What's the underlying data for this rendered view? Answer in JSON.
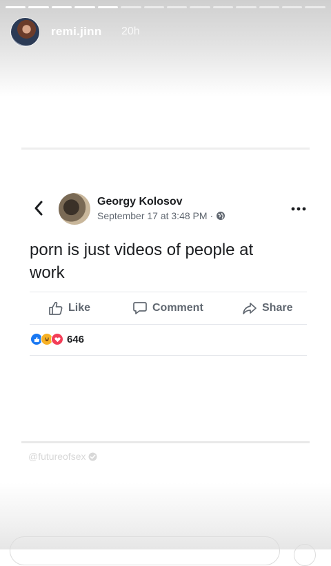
{
  "story": {
    "username": "remi.jinn",
    "time_ago": "20h",
    "progress": {
      "segments_total": 14,
      "segments_viewed": 5
    }
  },
  "post": {
    "author": "Georgy Kolosov",
    "timestamp": "September 17 at 3:48 PM",
    "separator": "·",
    "text": "porn is just videos of people at work",
    "actions": {
      "like": "Like",
      "comment": "Comment",
      "share": "Share"
    },
    "reaction_count": "646",
    "reaction_types": [
      "like",
      "haha",
      "love"
    ]
  },
  "watermark": {
    "text": "@futureofsex"
  },
  "colors": {
    "fb_blue": "#1877f2",
    "haha_yellow": "#f7b125",
    "love_red": "#f33e58",
    "text_gray": "#606770"
  }
}
